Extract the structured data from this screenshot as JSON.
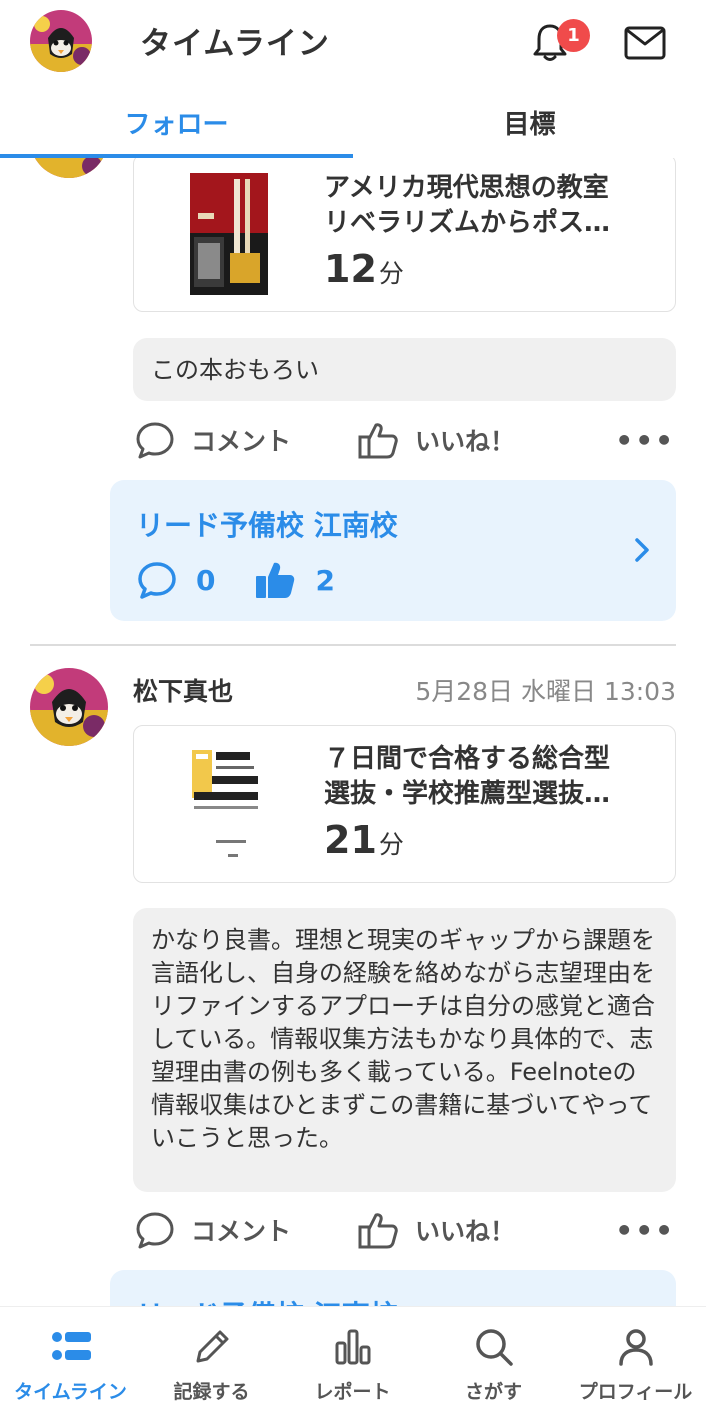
{
  "header": {
    "title": "タイムライン",
    "notification_count": "1"
  },
  "tabs": [
    {
      "label": "フォロー",
      "active": true
    },
    {
      "label": "目標",
      "active": false
    }
  ],
  "posts": [
    {
      "book": {
        "title_line1": "アメリカ現代思想の教室",
        "title_line2": "リベラリズムからポス…",
        "minutes": "12",
        "unit": "分"
      },
      "comment": "この本おもろい",
      "actions": {
        "comment": "コメント",
        "like": "いいね！",
        "more": "•••"
      },
      "group": {
        "name": "リード予備校 江南校",
        "comments": "0",
        "likes": "2"
      }
    },
    {
      "author": "松下真也",
      "date": "5月28日 水曜日 13:03",
      "book": {
        "title_line1": "７日間で合格する総合型",
        "title_line2": "選抜・学校推薦型選抜…",
        "minutes": "21",
        "unit": "分"
      },
      "comment": "かなり良書。理想と現実のギャップから課題を言語化し、自身の経験を絡めながら志望理由をリファインするアプローチは自分の感覚と適合している。情報収集方法もかなり具体的で、志望理由書の例も多く載っている。Feelnoteの情報収集はひとまずこの書籍に基づいてやっていこうと思った。",
      "actions": {
        "comment": "コメント",
        "like": "いいね！",
        "more": "•••"
      },
      "group": {
        "name": "リード予備校 江南校"
      }
    }
  ],
  "bottom_nav": [
    {
      "label": "タイムライン",
      "icon": "timeline-icon",
      "active": true
    },
    {
      "label": "記録する",
      "icon": "pencil-icon",
      "active": false
    },
    {
      "label": "レポート",
      "icon": "bar-chart-icon",
      "active": false
    },
    {
      "label": "さがす",
      "icon": "search-icon",
      "active": false
    },
    {
      "label": "プロフィール",
      "icon": "person-icon",
      "active": false
    }
  ],
  "colors": {
    "accent": "#2b8ce8",
    "badge": "#f04b4b",
    "group_bg": "#e8f3fd",
    "comment_bg": "#f0f0f0"
  }
}
